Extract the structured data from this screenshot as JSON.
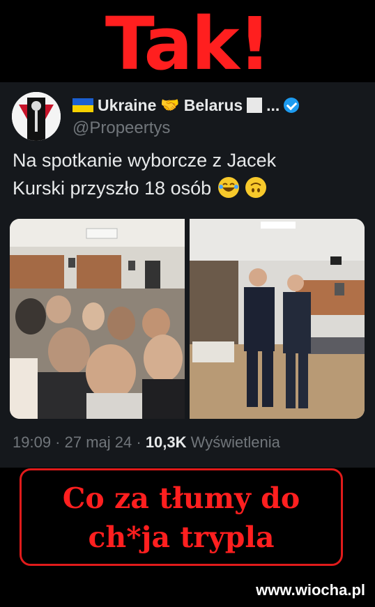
{
  "caption": {
    "top": "Tak!"
  },
  "tweet": {
    "display_name": "Ukraine",
    "display_name_2": "Belarus",
    "name_ellipsis": "...",
    "handle": "@Propeertys",
    "text_line1": "Na spotkanie wyborcze z Jacek",
    "text_line2": "Kurski przyszło 18 osób",
    "time": "19:09",
    "date": "27 maj 24",
    "views_count": "10,3K",
    "views_label": "Wyświetlenia",
    "separator": " · "
  },
  "comment": {
    "line1": "Co za tłumy do",
    "line2": "ch*ja trypla"
  },
  "watermark": "www.wiocha.pl",
  "colors": {
    "caption_red": "#ff1f1f",
    "card_bg": "#15181c",
    "verified_blue": "#1d9bf0",
    "muted_text": "#71767b"
  },
  "icons": [
    "ukraine-flag-icon",
    "handshake-icon",
    "white-square-icon",
    "verified-badge-icon",
    "laughing-emoji-icon",
    "upside-down-face-emoji-icon"
  ]
}
